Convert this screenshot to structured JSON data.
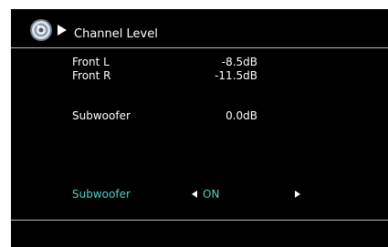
{
  "header": {
    "icon": "speaker-icon",
    "indicator_icon": "play-arrow-icon",
    "title": "Channel Level"
  },
  "channels": [
    {
      "label": "Front L",
      "value": "-8.5dB"
    },
    {
      "label": "Front R",
      "value": "-11.5dB"
    },
    {
      "label": "Subwoofer",
      "value": "0.0dB"
    }
  ],
  "setting": {
    "label": "Subwoofer",
    "value": "ON",
    "left_icon": "arrow-left-icon",
    "right_icon": "arrow-right-icon"
  },
  "colors": {
    "background": "#000000",
    "text": "#ffffff",
    "selected_text": "#4fcfc2",
    "divider": "#b8b8b8",
    "page": "#ffffff"
  }
}
